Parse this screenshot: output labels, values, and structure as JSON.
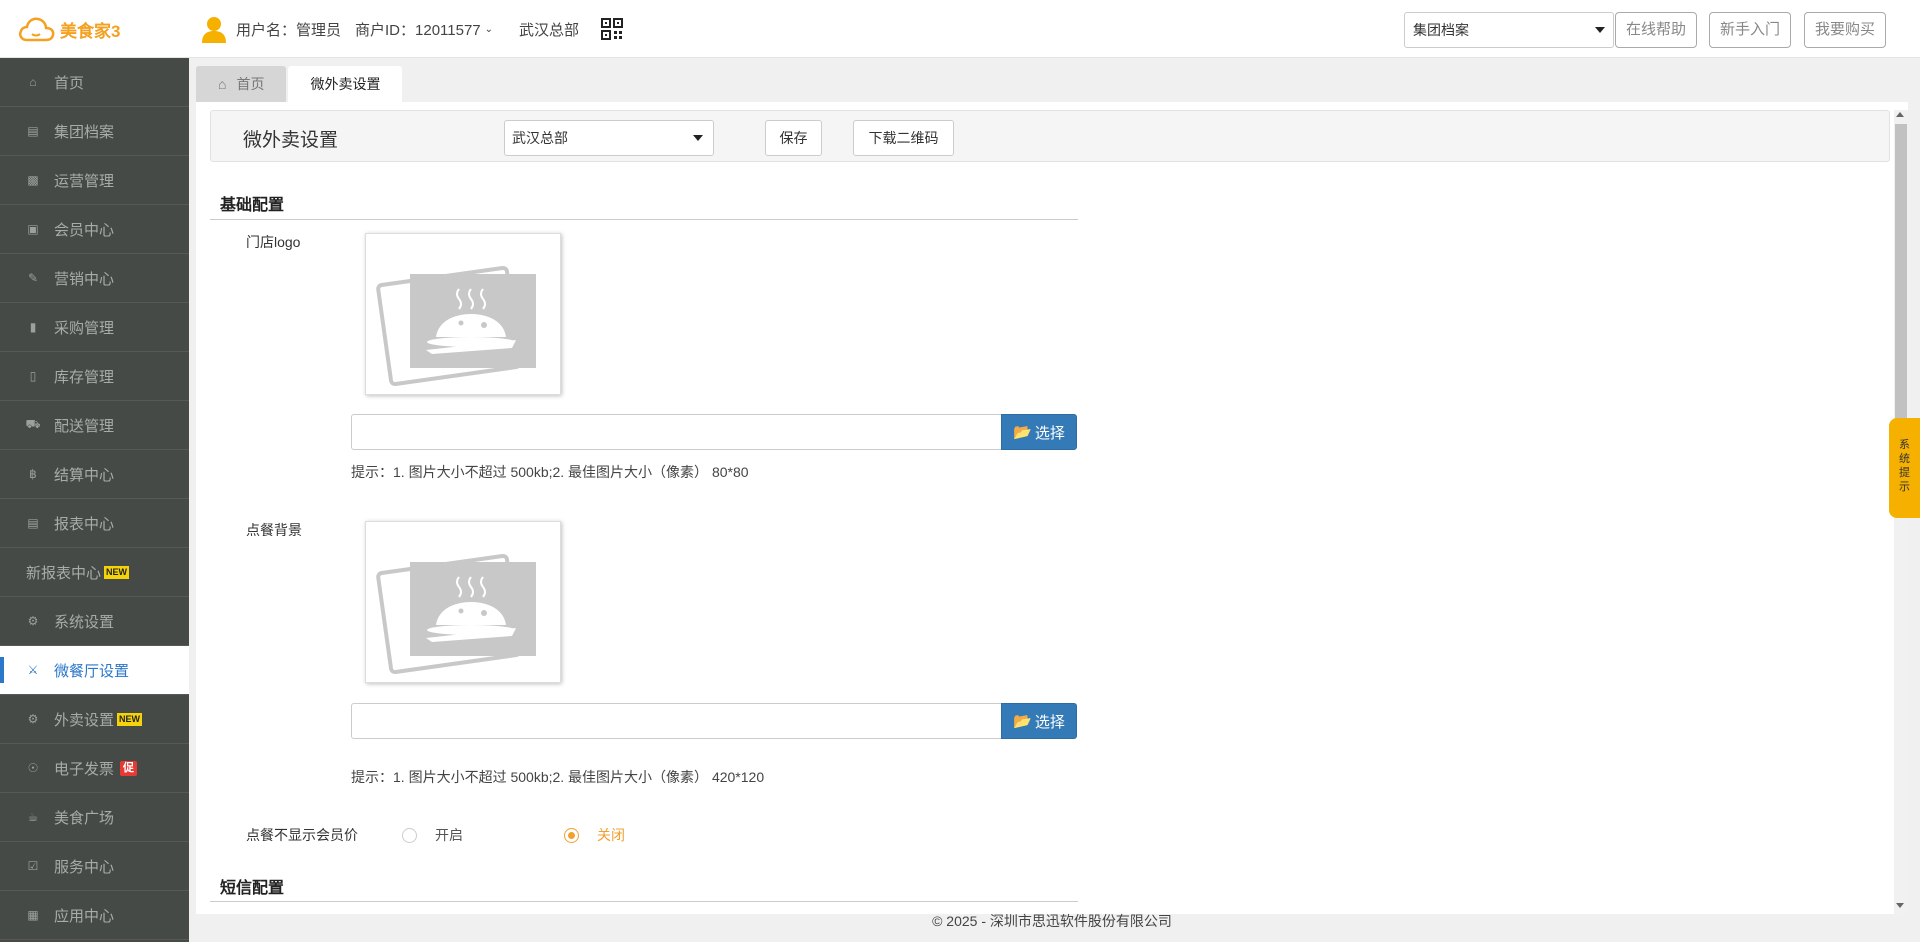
{
  "brand": {
    "name": "美食家3"
  },
  "header": {
    "user_label": "用户名：管理员",
    "merchant_id": "商户ID：12011577",
    "store": "武汉总部",
    "select_value": "集团档案",
    "buttons": {
      "help": "在线帮助",
      "guide": "新手入门",
      "buy": "我要购买"
    }
  },
  "sidebar": {
    "items": [
      {
        "label": "首页",
        "icon": "home-icon"
      },
      {
        "label": "集团档案",
        "icon": "file-icon"
      },
      {
        "label": "运营管理",
        "icon": "bar-chart-icon"
      },
      {
        "label": "会员中心",
        "icon": "id-card-icon"
      },
      {
        "label": "营销中心",
        "icon": "edit-icon"
      },
      {
        "label": "采购管理",
        "icon": "book-icon"
      },
      {
        "label": "库存管理",
        "icon": "tablet-icon"
      },
      {
        "label": "配送管理",
        "icon": "truck-icon"
      },
      {
        "label": "结算中心",
        "icon": "bitcoin-icon"
      },
      {
        "label": "报表中心",
        "icon": "report-icon"
      },
      {
        "label": "新报表中心",
        "badge": "NEW"
      },
      {
        "label": "系统设置",
        "icon": "gears-icon"
      },
      {
        "label": "微餐厅设置",
        "icon": "cutlery-icon"
      },
      {
        "label": "外卖设置",
        "icon": "gear-icon",
        "badge": "NEW"
      },
      {
        "label": "电子发票",
        "icon": "invoice-icon",
        "badge": "促"
      },
      {
        "label": "美食广场",
        "icon": "food-court-icon"
      },
      {
        "label": "服务中心",
        "icon": "service-icon"
      },
      {
        "label": "应用中心",
        "icon": "app-icon"
      }
    ]
  },
  "tabs": [
    {
      "label": "首页"
    },
    {
      "label": "微外卖设置"
    }
  ],
  "toolbar": {
    "title": "微外卖设置",
    "store_select": "武汉总部",
    "save": "保存",
    "download_qr": "下载二维码"
  },
  "basic": {
    "title": "基础配置",
    "logo_label": "门店logo",
    "logo_hint": "提示：1. 图片大小不超过 500kb;2. 最佳图片大小（像素） 80*80",
    "bg_label": "点餐背景",
    "bg_hint": "提示：1. 图片大小不超过 500kb;2. 最佳图片大小（像素） 420*120",
    "choose": "选择",
    "member_price_label": "点餐不显示会员价",
    "radio_on": "开启",
    "radio_off": "关闭"
  },
  "sms": {
    "title": "短信配置"
  },
  "side_tip": [
    "系",
    "统",
    "提",
    "示"
  ],
  "footer": "© 2025 - 深圳市思迅软件股份有限公司",
  "colors": {
    "accent": "#2b77c9",
    "brand": "#f5a020",
    "sidebar": "#464a46",
    "primary_button": "#337ab7",
    "radio_checked": "#f0a030",
    "tip": "#f5b000"
  }
}
